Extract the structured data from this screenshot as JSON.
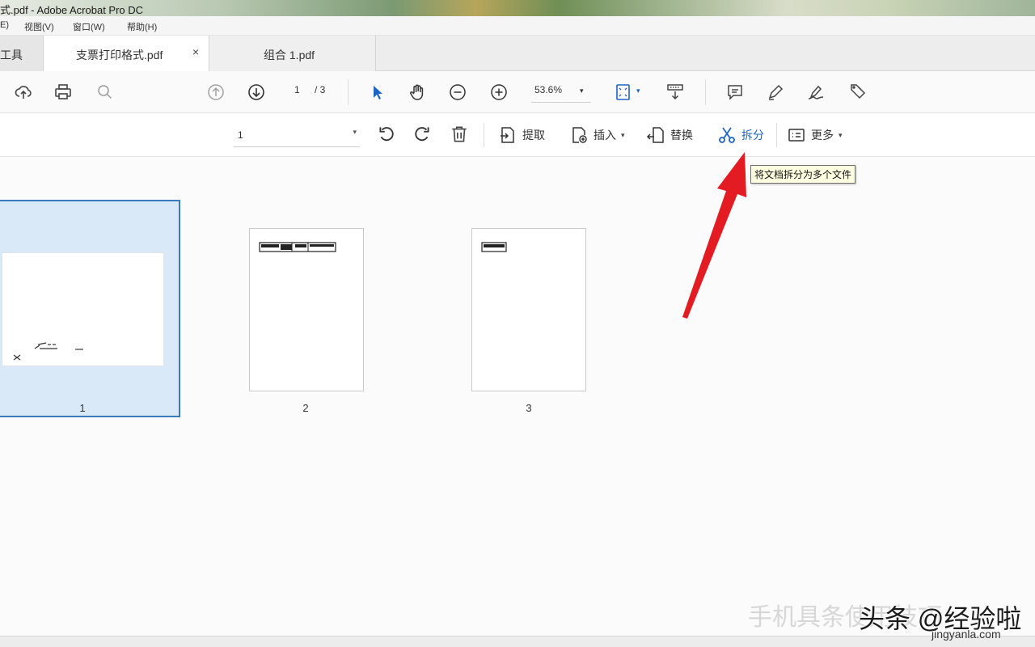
{
  "window": {
    "title": "式.pdf - Adobe Acrobat Pro DC"
  },
  "menu": {
    "items": [
      "E)",
      "视图(V)",
      "窗口(W)",
      "帮助(H)"
    ]
  },
  "tabs": {
    "tools": "工具",
    "active": "支票打印格式.pdf",
    "close": "×",
    "second": "组合 1.pdf"
  },
  "toolbar": {
    "page_current": "1",
    "page_total": "/ 3",
    "zoom": "53.6%",
    "zoom_caret": "▾",
    "icons": [
      "upload-icon",
      "print-icon",
      "zoom-search-icon",
      "page-up-icon",
      "page-down-icon",
      "select-arrow-icon",
      "hand-icon",
      "zoom-out-icon",
      "zoom-in-icon",
      "fit-page-icon",
      "scroll-mode-icon",
      "comment-icon",
      "pen-icon",
      "sign-icon",
      "share-icon"
    ]
  },
  "organize": {
    "page_select": "1",
    "page_select_caret": "▾",
    "extract": "提取",
    "insert": "插入",
    "insert_caret": "▾",
    "replace": "替换",
    "split": "拆分",
    "more": "更多",
    "more_caret": "▾",
    "tooltip": "将文档拆分为多个文件"
  },
  "thumbnails": [
    {
      "label": "1",
      "selected": true
    },
    {
      "label": "2",
      "selected": false
    },
    {
      "label": "3",
      "selected": false
    }
  ],
  "watermark": {
    "text1": "手机具条使用技巧",
    "text2": "头条 @经验啦",
    "site": "jingyanla.com"
  },
  "colors": {
    "accent": "#1d64c4",
    "selection": "#d9e9f8",
    "arrow": "#e31b23"
  }
}
